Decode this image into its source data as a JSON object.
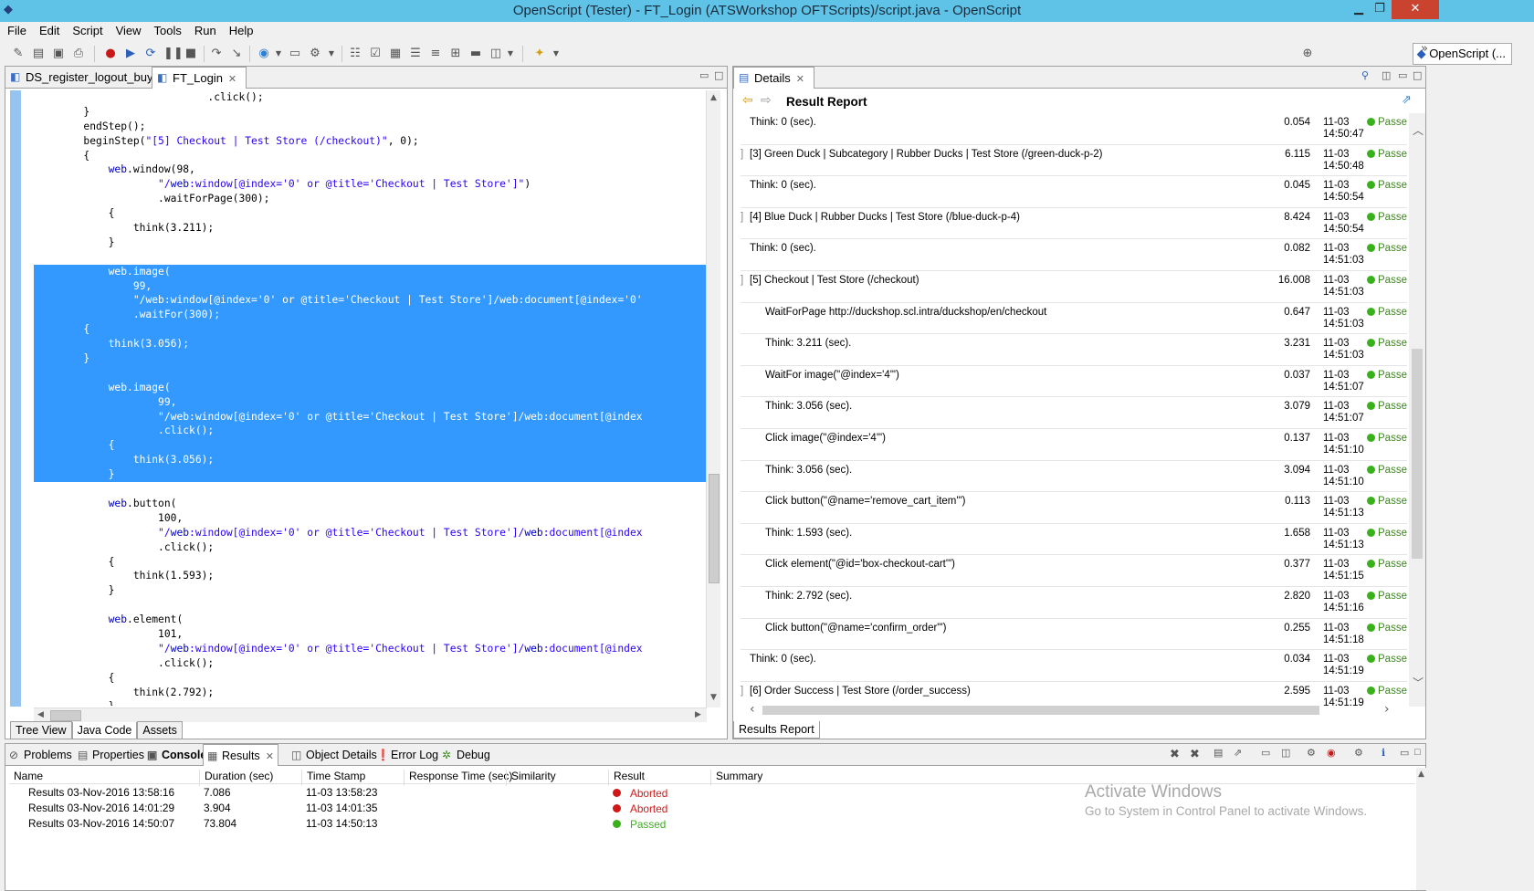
{
  "window": {
    "title": "OpenScript (Tester) - FT_Login (ATSWorkshop  OFTScripts)/script.java - OpenScript",
    "min": "▁",
    "max": "❐",
    "close": "✕"
  },
  "menu": [
    "File",
    "Edit",
    "Script",
    "View",
    "Tools",
    "Run",
    "Help"
  ],
  "perspective": "OpenScript (...",
  "editor": {
    "tabs": [
      {
        "label": "DS_register_logout_buy"
      },
      {
        "label": "FT_Login"
      }
    ],
    "bottom_tabs": [
      "Tree View",
      "Java Code",
      "Assets"
    ],
    "lines": [
      {
        "text": "                            .click();",
        "sel": false
      },
      {
        "text": "        }",
        "sel": false
      },
      {
        "text": "        endStep();",
        "sel": false
      },
      {
        "text": "        beginStep(\"[5] Checkout | Test Store (/checkout)\", 0);",
        "sel": false
      },
      {
        "text": "        {",
        "sel": false
      },
      {
        "text": "            web.window(98,",
        "sel": false
      },
      {
        "text": "                    \"/web:window[@index='0' or @title='Checkout | Test Store']\")",
        "sel": false
      },
      {
        "text": "                    .waitForPage(300);",
        "sel": false
      },
      {
        "text": "            {",
        "sel": false
      },
      {
        "text": "                think(3.211);",
        "sel": false
      },
      {
        "text": "            }",
        "sel": false
      },
      {
        "text": "",
        "sel": false
      },
      {
        "text": "            web.image(",
        "sel": true
      },
      {
        "text": "                99,",
        "sel": true
      },
      {
        "text": "                \"/web:window[@index='0' or @title='Checkout | Test Store']/web:document[@index='0'",
        "sel": true
      },
      {
        "text": "                .waitFor(300);",
        "sel": true
      },
      {
        "text": "        {",
        "sel": true
      },
      {
        "text": "            think(3.056);",
        "sel": true
      },
      {
        "text": "        }",
        "sel": true
      },
      {
        "text": "",
        "sel": true
      },
      {
        "text": "            web.image(",
        "sel": true
      },
      {
        "text": "                    99,",
        "sel": true
      },
      {
        "text": "                    \"/web:window[@index='0' or @title='Checkout | Test Store']/web:document[@index",
        "sel": true
      },
      {
        "text": "                    .click();",
        "sel": true
      },
      {
        "text": "            {",
        "sel": true
      },
      {
        "text": "                think(3.056);",
        "sel": true
      },
      {
        "text": "            }",
        "sel": true
      },
      {
        "text": "",
        "sel": false
      },
      {
        "text": "            web.button(",
        "sel": false
      },
      {
        "text": "                    100,",
        "sel": false
      },
      {
        "text": "                    \"/web:window[@index='0' or @title='Checkout | Test Store']/web:document[@index",
        "sel": false
      },
      {
        "text": "                    .click();",
        "sel": false
      },
      {
        "text": "            {",
        "sel": false
      },
      {
        "text": "                think(1.593);",
        "sel": false
      },
      {
        "text": "            }",
        "sel": false
      },
      {
        "text": "",
        "sel": false
      },
      {
        "text": "            web.element(",
        "sel": false
      },
      {
        "text": "                    101,",
        "sel": false
      },
      {
        "text": "                    \"/web:window[@index='0' or @title='Checkout | Test Store']/web:document[@index",
        "sel": false
      },
      {
        "text": "                    .click();",
        "sel": false
      },
      {
        "text": "            {",
        "sel": false
      },
      {
        "text": "                think(2.792);",
        "sel": false
      },
      {
        "text": "            }",
        "sel": false
      }
    ]
  },
  "details": {
    "tab": "Details",
    "title": "Result Report",
    "bottom_tab": "Results Report",
    "rows": [
      {
        "indent": 0,
        "branch": false,
        "name": "Think: 0 (sec).",
        "dur": "0.054",
        "ts1": "11-03",
        "ts2": "14:50:47",
        "status": "Passed"
      },
      {
        "indent": 0,
        "branch": true,
        "name": "[3] Green Duck | Subcategory | Rubber Ducks | Test Store (/green-duck-p-2)",
        "dur": "6.115",
        "ts1": "11-03",
        "ts2": "14:50:48",
        "status": "Passed"
      },
      {
        "indent": 0,
        "branch": false,
        "name": "Think: 0 (sec).",
        "dur": "0.045",
        "ts1": "11-03",
        "ts2": "14:50:54",
        "status": "Passed"
      },
      {
        "indent": 0,
        "branch": true,
        "name": "[4] Blue Duck | Rubber Ducks | Test Store (/blue-duck-p-4)",
        "dur": "8.424",
        "ts1": "11-03",
        "ts2": "14:50:54",
        "status": "Passed"
      },
      {
        "indent": 0,
        "branch": false,
        "name": "Think: 0 (sec).",
        "dur": "0.082",
        "ts1": "11-03",
        "ts2": "14:51:03",
        "status": "Passed"
      },
      {
        "indent": 0,
        "branch": true,
        "name": "[5] Checkout | Test Store (/checkout)",
        "dur": "16.008",
        "ts1": "11-03",
        "ts2": "14:51:03",
        "status": "Passed"
      },
      {
        "indent": 1,
        "branch": false,
        "name": "WaitForPage http://duckshop.scl.intra/duckshop/en/checkout",
        "dur": "0.647",
        "ts1": "11-03",
        "ts2": "14:51:03",
        "status": "Passed"
      },
      {
        "indent": 1,
        "branch": false,
        "name": "Think: 3.211 (sec).",
        "dur": "3.231",
        "ts1": "11-03",
        "ts2": "14:51:03",
        "status": "Passed"
      },
      {
        "indent": 1,
        "branch": false,
        "name": "WaitFor image(\"@index='4'\")",
        "dur": "0.037",
        "ts1": "11-03",
        "ts2": "14:51:07",
        "status": "Passed"
      },
      {
        "indent": 1,
        "branch": false,
        "name": "Think: 3.056 (sec).",
        "dur": "3.079",
        "ts1": "11-03",
        "ts2": "14:51:07",
        "status": "Passed"
      },
      {
        "indent": 1,
        "branch": false,
        "name": "Click image(\"@index='4'\")",
        "dur": "0.137",
        "ts1": "11-03",
        "ts2": "14:51:10",
        "status": "Passed"
      },
      {
        "indent": 1,
        "branch": false,
        "name": "Think: 3.056 (sec).",
        "dur": "3.094",
        "ts1": "11-03",
        "ts2": "14:51:10",
        "status": "Passed"
      },
      {
        "indent": 1,
        "branch": false,
        "name": "Click button(\"@name='remove_cart_item'\")",
        "dur": "0.113",
        "ts1": "11-03",
        "ts2": "14:51:13",
        "status": "Passed"
      },
      {
        "indent": 1,
        "branch": false,
        "name": "Think: 1.593 (sec).",
        "dur": "1.658",
        "ts1": "11-03",
        "ts2": "14:51:13",
        "status": "Passed"
      },
      {
        "indent": 1,
        "branch": false,
        "name": "Click element(\"@id='box-checkout-cart'\")",
        "dur": "0.377",
        "ts1": "11-03",
        "ts2": "14:51:15",
        "status": "Passed"
      },
      {
        "indent": 1,
        "branch": false,
        "name": "Think: 2.792 (sec).",
        "dur": "2.820",
        "ts1": "11-03",
        "ts2": "14:51:16",
        "status": "Passed"
      },
      {
        "indent": 1,
        "branch": false,
        "name": "Click button(\"@name='confirm_order'\")",
        "dur": "0.255",
        "ts1": "11-03",
        "ts2": "14:51:18",
        "status": "Passed"
      },
      {
        "indent": 0,
        "branch": false,
        "name": "Think: 0 (sec).",
        "dur": "0.034",
        "ts1": "11-03",
        "ts2": "14:51:19",
        "status": "Passed"
      },
      {
        "indent": 0,
        "branch": true,
        "name": "[6] Order Success | Test Store (/order_success)",
        "dur": "2.595",
        "ts1": "11-03",
        "ts2": "14:51:19",
        "status": "Passed"
      }
    ]
  },
  "bottom": {
    "tabs": [
      "Problems",
      "Properties",
      "Console",
      "Results",
      "Object Details",
      "Error Log",
      "Debug"
    ],
    "columns": [
      "Name",
      "Duration (sec)",
      "Time Stamp",
      "Response Time (sec)",
      "Similarity",
      "Result",
      "Summary"
    ],
    "results": [
      {
        "name": "Results 03-Nov-2016 13:58:16",
        "dur": "7.086",
        "ts": "11-03 13:58:23",
        "result": "Aborted",
        "color": "#d01818"
      },
      {
        "name": "Results 03-Nov-2016 14:01:29",
        "dur": "3.904",
        "ts": "11-03 14:01:35",
        "result": "Aborted",
        "color": "#d01818"
      },
      {
        "name": "Results 03-Nov-2016 14:50:07",
        "dur": "73.804",
        "ts": "11-03 14:50:13",
        "result": "Passed",
        "color": "#39b11b"
      }
    ]
  },
  "watermark": {
    "line1": "Activate Windows",
    "line2": "Go to System in Control Panel to activate Windows."
  }
}
